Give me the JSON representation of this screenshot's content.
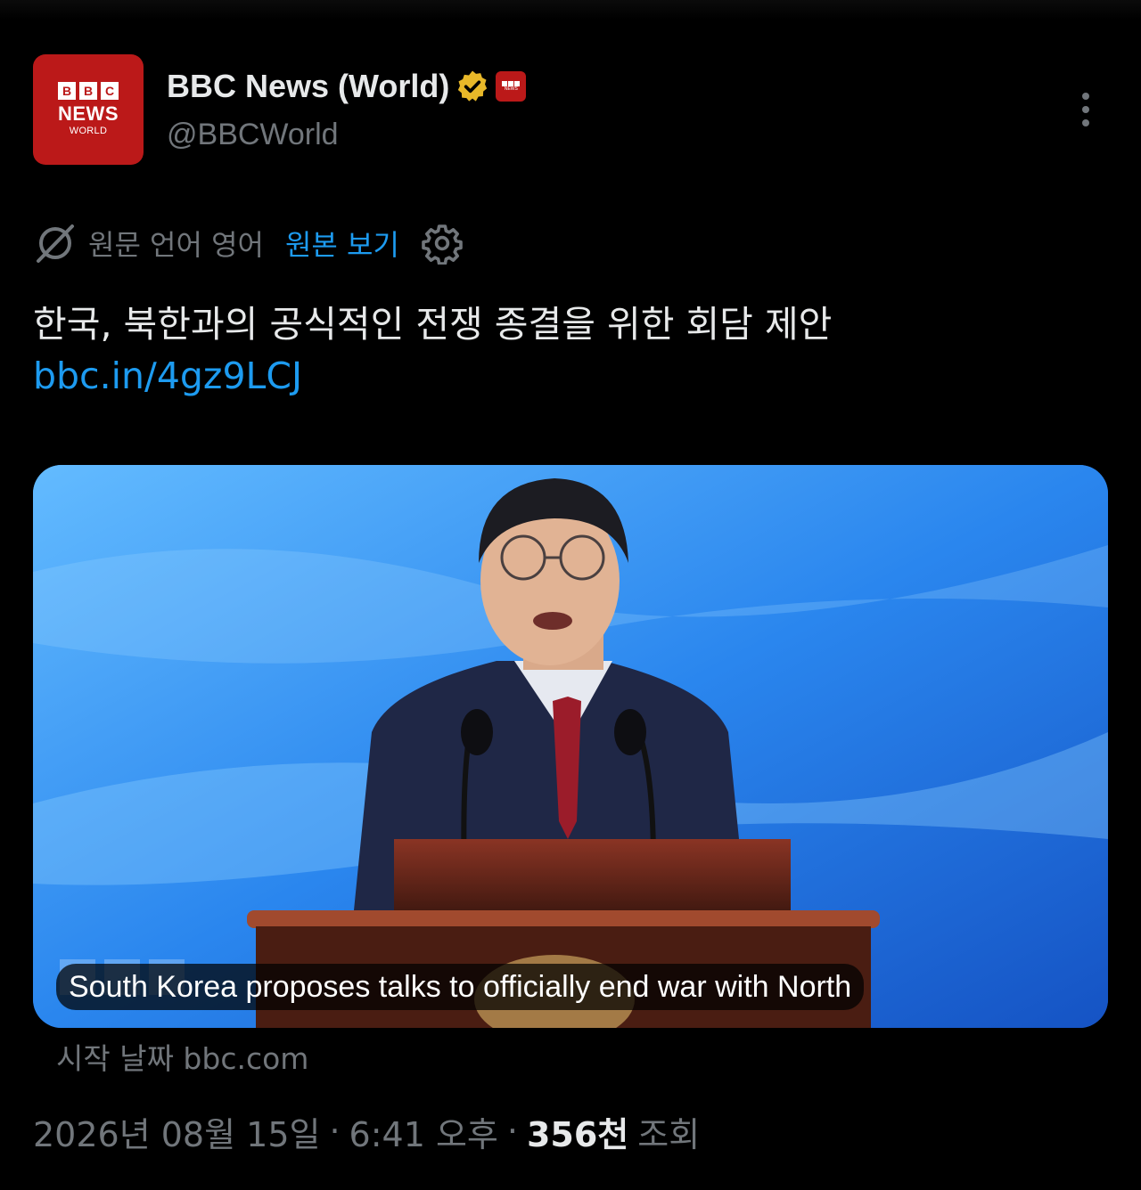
{
  "account": {
    "avatar_bbc_letters": [
      "B",
      "B",
      "C"
    ],
    "avatar_news": "NEWS",
    "avatar_world": "WORLD",
    "display_name": "BBC News (World)",
    "handle": "@BBCWorld",
    "verified_color": "#e8b829",
    "brand_color": "#bb1919"
  },
  "translation": {
    "source_language_label": "원문 언어 영어",
    "show_original_label": "원본 보기"
  },
  "tweet": {
    "text": "한국, 북한과의 공식적인 전쟁 종결을 위한 회담 제안 ",
    "link_text": "bbc.in/4gz9LCJ"
  },
  "card": {
    "caption": "South Korea proposes talks to officially end war with North",
    "source": "시작 날짜 bbc.com"
  },
  "meta": {
    "date": "2026년 08월 15일",
    "separator": "·",
    "time": "6:41 오후",
    "views_count": "356천",
    "views_label": "조회"
  },
  "colors": {
    "link": "#1d9bf0",
    "secondary_text": "#71767b",
    "primary_text": "#e7e9ea"
  }
}
